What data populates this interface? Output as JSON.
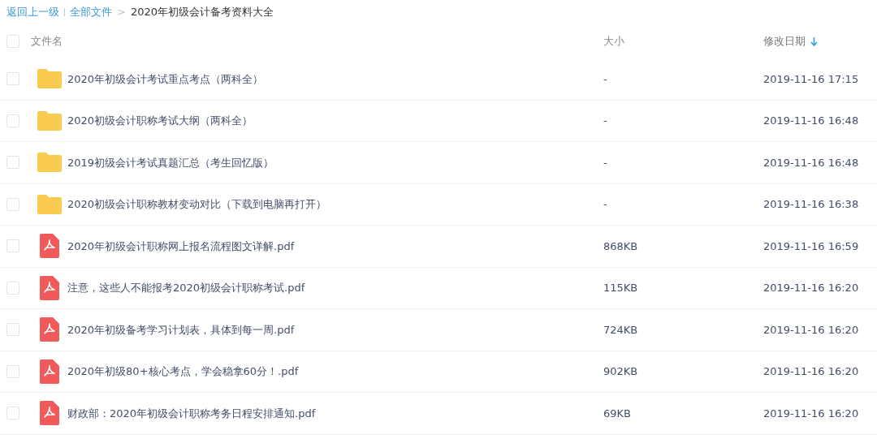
{
  "breadcrumb": {
    "back": "返回上一级",
    "root": "全部文件",
    "separator": ">",
    "current": "2020年初级会计备考资料大全"
  },
  "header": {
    "checked": false,
    "columns": [
      {
        "label": "文件名",
        "sorted": false
      },
      {
        "label": "大小",
        "sorted": false
      },
      {
        "label": "修改日期",
        "sorted": true
      }
    ]
  },
  "rows": [
    {
      "kind": "folder",
      "name": "2020年初级会计考试重点考点（两科全）",
      "size": "-",
      "date": "2019-11-16 17:15",
      "checked": false
    },
    {
      "kind": "folder",
      "name": "2020初级会计职称考试大纲（两科全）",
      "size": "-",
      "date": "2019-11-16 16:48",
      "checked": false
    },
    {
      "kind": "folder",
      "name": "2019初级会计考试真题汇总（考生回忆版）",
      "size": "-",
      "date": "2019-11-16 16:48",
      "checked": false
    },
    {
      "kind": "folder",
      "name": "2020初级会计职称教材变动对比（下载到电脑再打开）",
      "size": "-",
      "date": "2019-11-16 16:38",
      "checked": false
    },
    {
      "kind": "pdf",
      "name": "2020年初级会计职称网上报名流程图文详解.pdf",
      "size": "868KB",
      "date": "2019-11-16 16:59",
      "checked": false
    },
    {
      "kind": "pdf",
      "name": "注意，这些人不能报考2020初级会计职称考试.pdf",
      "size": "115KB",
      "date": "2019-11-16 16:20",
      "checked": false
    },
    {
      "kind": "pdf",
      "name": "2020年初级备考学习计划表，具体到每一周.pdf",
      "size": "724KB",
      "date": "2019-11-16 16:20",
      "checked": false
    },
    {
      "kind": "pdf",
      "name": "2020年初级80+核心考点，学会稳拿60分！.pdf",
      "size": "902KB",
      "date": "2019-11-16 16:20",
      "checked": false
    },
    {
      "kind": "pdf",
      "name": "财政部：2020年初级会计职称考务日程安排通知.pdf",
      "size": "69KB",
      "date": "2019-11-16 16:20",
      "checked": false
    }
  ]
}
